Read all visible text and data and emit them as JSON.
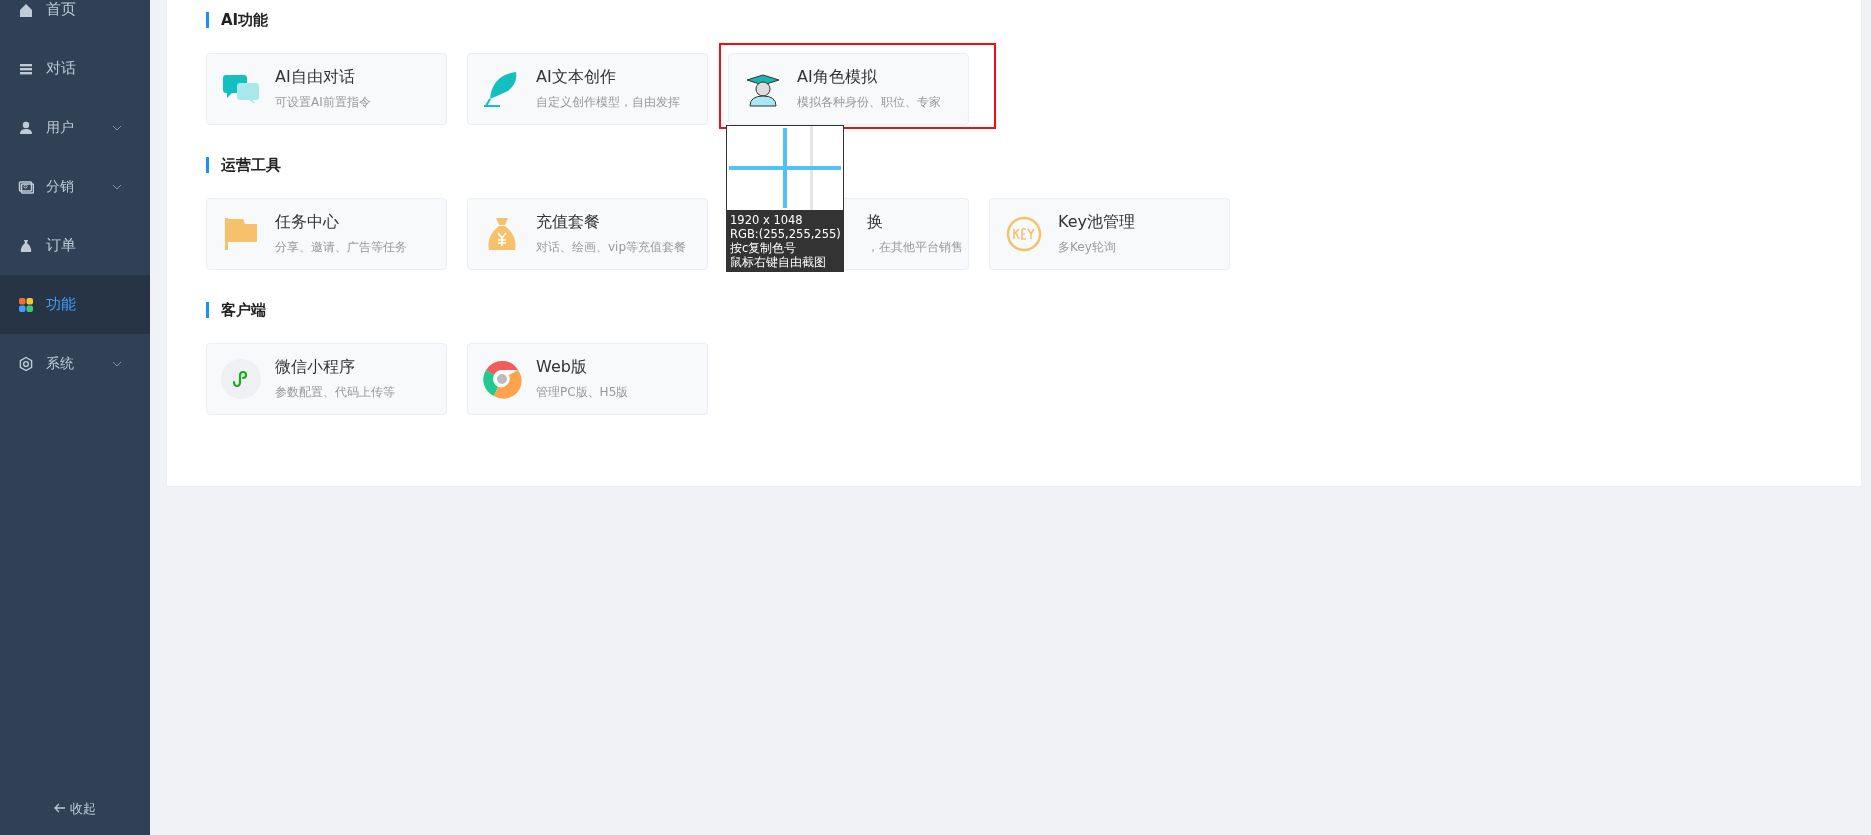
{
  "sidebar": {
    "items": [
      {
        "label": "首页",
        "expandable": false,
        "selected": false
      },
      {
        "label": "对话",
        "expandable": false,
        "selected": false
      },
      {
        "label": "用户",
        "expandable": true,
        "selected": false
      },
      {
        "label": "分销",
        "expandable": true,
        "selected": false
      },
      {
        "label": "订单",
        "expandable": false,
        "selected": false
      },
      {
        "label": "功能",
        "expandable": false,
        "selected": true
      },
      {
        "label": "系统",
        "expandable": true,
        "selected": false
      }
    ],
    "collapse_label": "收起"
  },
  "sections": [
    {
      "title": "AI功能",
      "cards": [
        {
          "title": "AI自由对话",
          "description": "可设置AI前置指令"
        },
        {
          "title": "AI文本创作",
          "description": "自定义创作模型，自由发挥"
        },
        {
          "title": "AI角色模拟",
          "description": "模拟各种身份、职位、专家",
          "highlighted": true
        }
      ]
    },
    {
      "title": "运营工具",
      "cards": [
        {
          "title": "任务中心",
          "description": "分享、邀请、广告等任务"
        },
        {
          "title": "充值套餐",
          "description": "对话、绘画、vip等充值套餐"
        },
        {
          "title": "换",
          "description": "，在其他平台销售"
        },
        {
          "title": "Key池管理",
          "description": "多Key轮询"
        }
      ]
    },
    {
      "title": "客户端",
      "cards": [
        {
          "title": "微信小程序",
          "description": "参数配置、代码上传等"
        },
        {
          "title": "Web版",
          "description": "管理PC版、H5版"
        }
      ]
    }
  ],
  "screen_tool": {
    "lines": [
      "1920 x 1048",
      "RGB:(255,255,255)",
      "按c复制色号",
      "鼠标右键自由截图"
    ]
  }
}
